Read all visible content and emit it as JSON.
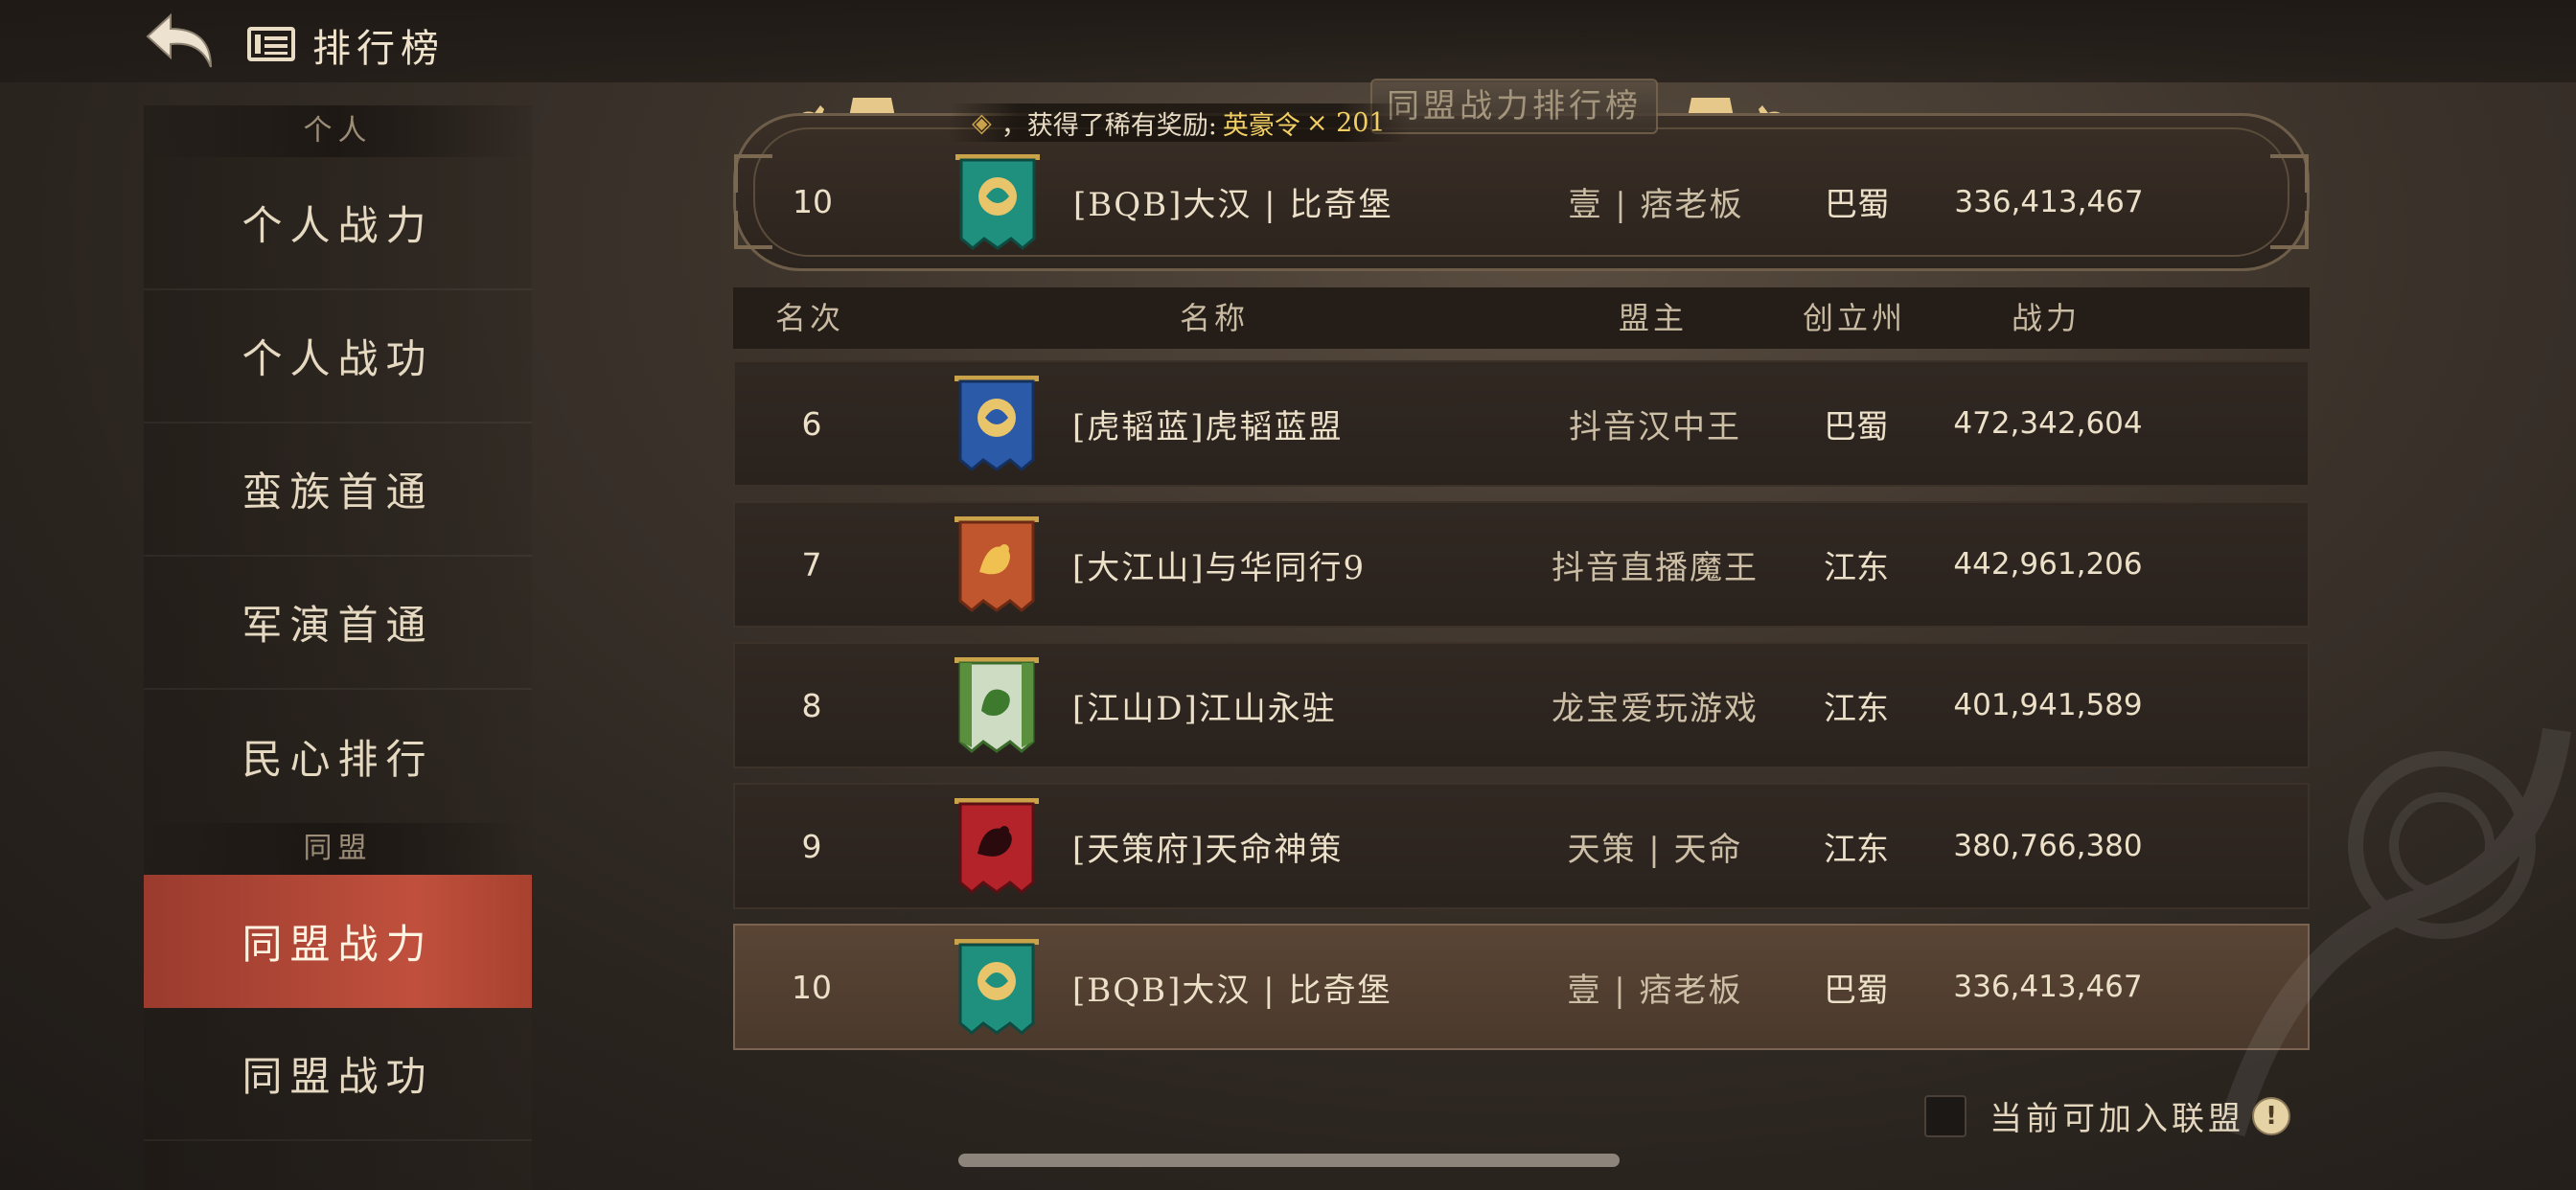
{
  "header": {
    "title": "排行榜",
    "back_icon": "back-arrow-icon",
    "title_icon": "ranking-board-icon"
  },
  "sidebar": {
    "personal_header": "个人",
    "alliance_header": "同盟",
    "personal_items": [
      {
        "label": "个人战力"
      },
      {
        "label": "个人战功"
      },
      {
        "label": "蛮族首通"
      },
      {
        "label": "军演首通"
      },
      {
        "label": "民心排行"
      }
    ],
    "alliance_items": [
      {
        "label": "同盟战力",
        "active": true
      },
      {
        "label": "同盟战功"
      }
    ]
  },
  "banner": {
    "tab_label": "同盟战力排行榜",
    "notice_text": "，获得了稀有奖励:",
    "notice_item": "英豪令",
    "notice_count": "× 201",
    "my_alliance": {
      "rank": "10",
      "name": "[BQB]大汉 | 比奇堡",
      "leader": "壹 | 痞老板",
      "state": "巴蜀",
      "power": "336,413,467",
      "flag": "teal"
    }
  },
  "table": {
    "headers": {
      "rank": "名次",
      "name": "名称",
      "leader": "盟主",
      "state": "创立州",
      "power": "战力"
    },
    "rows": [
      {
        "rank": "6",
        "name": "[虎韬蓝]虎韬蓝盟",
        "leader": "抖音汉中王",
        "state": "巴蜀",
        "power": "472,342,604",
        "flag": "blue"
      },
      {
        "rank": "7",
        "name": "[大江山]与华同行9",
        "leader": "抖音直播魔王",
        "state": "江东",
        "power": "442,961,206",
        "flag": "orange"
      },
      {
        "rank": "8",
        "name": "[江山D]江山永驻",
        "leader": "龙宝爱玩游戏",
        "state": "江东",
        "power": "401,941,589",
        "flag": "green"
      },
      {
        "rank": "9",
        "name": "[天策府]天命神策",
        "leader": "天策 | 天命",
        "state": "江东",
        "power": "380,766,380",
        "flag": "red"
      },
      {
        "rank": "10",
        "name": "[BQB]大汉 | 比奇堡",
        "leader": "壹 | 痞老板",
        "state": "巴蜀",
        "power": "336,413,467",
        "flag": "teal",
        "highlight": true
      }
    ]
  },
  "footer": {
    "checkbox_label": "当前可加入联盟",
    "info_icon_text": "!"
  },
  "colors": {
    "active_tab": "#c0503d",
    "reward_text": "#f2cf63",
    "flag_teal": "#1f8f7e",
    "flag_blue": "#2a5aa8",
    "flag_orange": "#c0562e",
    "flag_green": "#5a8f3e",
    "flag_red": "#b4232a"
  }
}
